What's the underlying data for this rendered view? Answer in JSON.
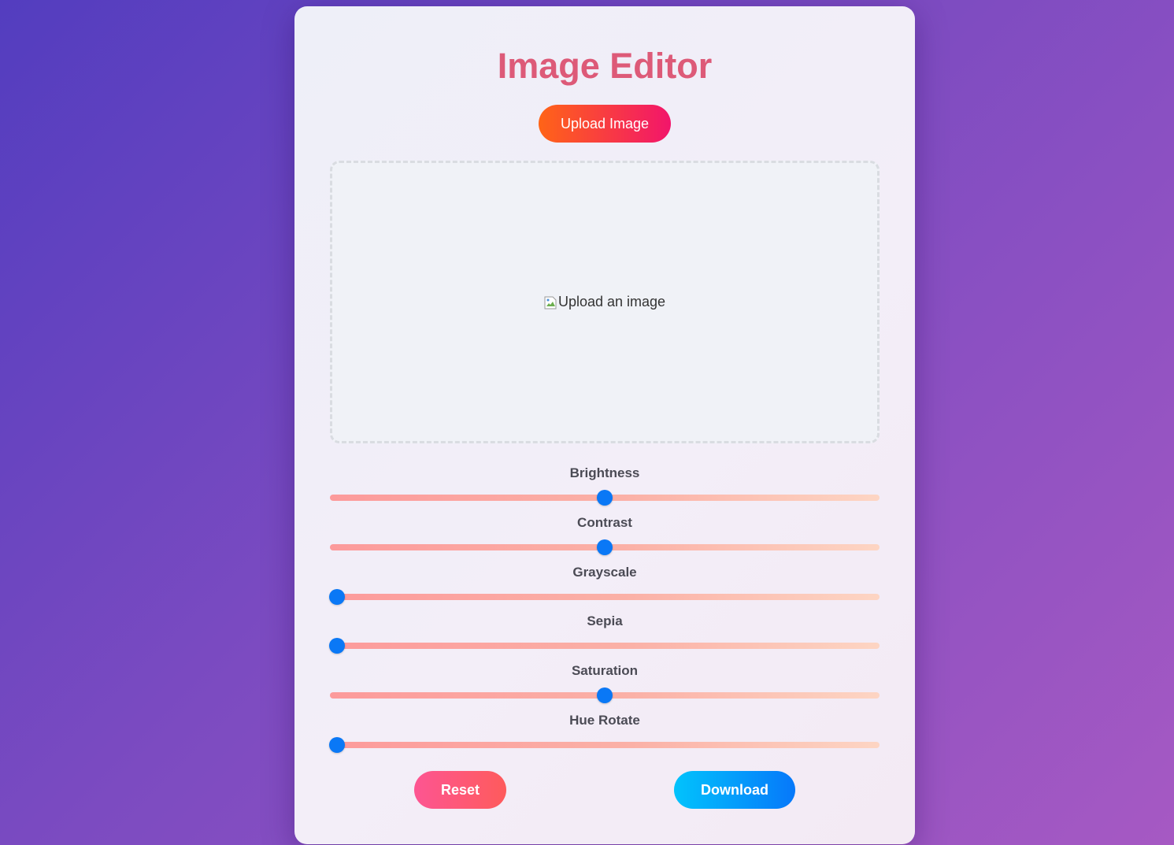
{
  "title": "Image Editor",
  "upload_button_label": "Upload Image",
  "preview": {
    "alt_text": "Upload an image",
    "broken_image_icon": "broken-image-icon"
  },
  "controls": [
    {
      "label": "Brightness",
      "value": 0.5
    },
    {
      "label": "Contrast",
      "value": 0.5
    },
    {
      "label": "Grayscale",
      "value": 0
    },
    {
      "label": "Sepia",
      "value": 0
    },
    {
      "label": "Saturation",
      "value": 0.5
    },
    {
      "label": "Hue Rotate",
      "value": 0
    }
  ],
  "buttons": {
    "reset": "Reset",
    "download": "Download"
  },
  "colors": {
    "title": "#dd5a78",
    "slider_thumb": "#0a78f6",
    "upload_gradient": [
      "#ff6417",
      "#f2156b"
    ],
    "reset_gradient": [
      "#fd5592",
      "#fe5b5c"
    ],
    "download_gradient": [
      "#02c3fc",
      "#0678fa"
    ]
  }
}
